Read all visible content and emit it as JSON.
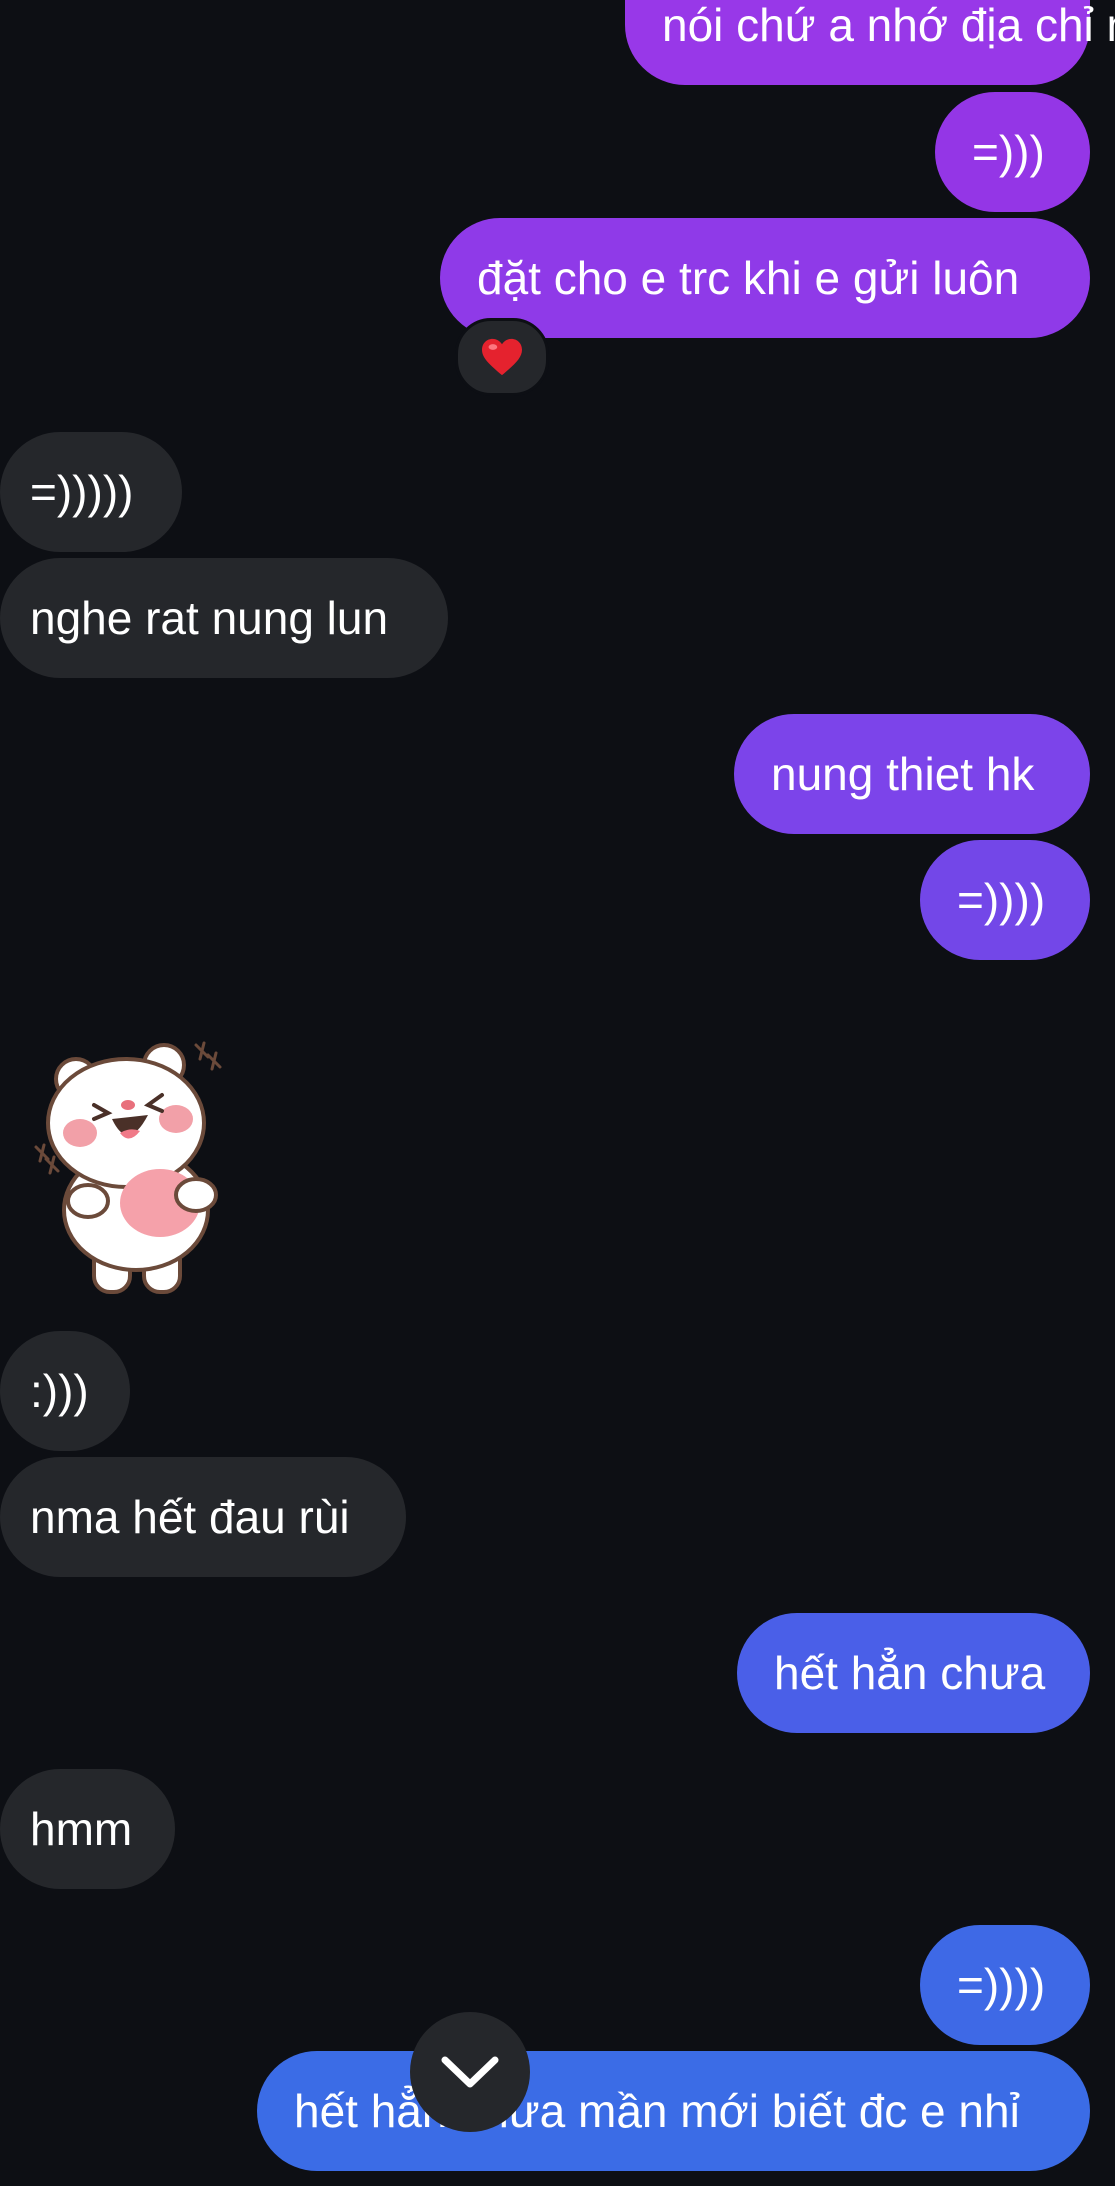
{
  "messages": [
    {
      "dir": "sent",
      "text": "nói chứ a nhớ địa chỉ  mà",
      "color": "#9838e8"
    },
    {
      "dir": "sent",
      "text": "=)))",
      "color": "#9436e6"
    },
    {
      "dir": "sent",
      "text": "đặt cho e trc khi e gửi luôn",
      "color": "#8f3ae8",
      "reaction": "❤️"
    },
    {
      "dir": "recv",
      "text": "=)))))"
    },
    {
      "dir": "recv",
      "text": "nghe rat nung lun"
    },
    {
      "dir": "sent",
      "text": "nung thiet hk",
      "color": "#7c44ea"
    },
    {
      "dir": "sent",
      "text": "=))))",
      "color": "#7347e8"
    },
    {
      "dir": "recv",
      "sticker": "white-bear-laughing-sticker"
    },
    {
      "dir": "recv",
      "text": ":)))"
    },
    {
      "dir": "recv",
      "text": "nma hết đau rùi"
    },
    {
      "dir": "sent",
      "text": "hết hẳn chưa",
      "color": "#4a5fe8"
    },
    {
      "dir": "recv",
      "text": "hmm"
    },
    {
      "dir": "sent",
      "text": "=))))",
      "color": "#3e69e6"
    },
    {
      "dir": "sent",
      "text": "hết hẳn chưa mần mới biết đc e nhỉ",
      "color": "#3b6ce6"
    }
  ],
  "scroll_button": {
    "icon": "chevron-down-icon"
  },
  "colors": {
    "background": "#0d0f14",
    "received_bubble": "#25272b"
  }
}
